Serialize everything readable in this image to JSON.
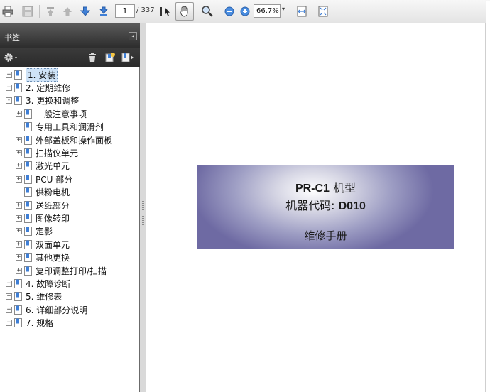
{
  "toolbar": {
    "page_current": "1",
    "page_total": "/ 337",
    "zoom_value": "66.7%",
    "icons": [
      "printer-icon",
      "save-icon",
      "first-page-icon",
      "prev-page-icon",
      "next-page-icon",
      "last-page-icon",
      "select-tool-icon",
      "hand-tool-icon",
      "zoom-tool-icon",
      "zoom-out-icon",
      "zoom-in-icon",
      "fit-width-icon",
      "fit-page-icon"
    ]
  },
  "panel": {
    "title": "书签",
    "collapse_symbol": "◂",
    "tools": [
      "options-gear-icon",
      "delete-bookmark-icon",
      "new-bookmark-icon",
      "expand-bookmark-icon"
    ]
  },
  "bookmarks": [
    {
      "label": "1. 安装",
      "level": 0,
      "state": "+",
      "selected": true
    },
    {
      "label": "2. 定期维修",
      "level": 0,
      "state": "+"
    },
    {
      "label": "3. 更换和调整",
      "level": 0,
      "state": "-"
    },
    {
      "label": "一般注意事项",
      "level": 1,
      "state": "+"
    },
    {
      "label": "专用工具和润滑剂",
      "level": 1,
      "state": ""
    },
    {
      "label": "外部盖板和操作面板",
      "level": 1,
      "state": "+"
    },
    {
      "label": "扫描仪单元",
      "level": 1,
      "state": "+"
    },
    {
      "label": "激光单元",
      "level": 1,
      "state": "+"
    },
    {
      "label": "PCU 部分",
      "level": 1,
      "state": "+"
    },
    {
      "label": "供粉电机",
      "level": 1,
      "state": ""
    },
    {
      "label": "送纸部分",
      "level": 1,
      "state": "+"
    },
    {
      "label": "图像转印",
      "level": 1,
      "state": "+"
    },
    {
      "label": "定影",
      "level": 1,
      "state": "+"
    },
    {
      "label": "双面单元",
      "level": 1,
      "state": "+"
    },
    {
      "label": "其他更换",
      "level": 1,
      "state": "+"
    },
    {
      "label": "复印调整打印/扫描",
      "level": 1,
      "state": "+"
    },
    {
      "label": "4. 故障诊断",
      "level": 0,
      "state": "+"
    },
    {
      "label": "5. 维修表",
      "level": 0,
      "state": "+"
    },
    {
      "label": "6. 详细部分说明",
      "level": 0,
      "state": "+"
    },
    {
      "label": "7. 规格",
      "level": 0,
      "state": "+"
    }
  ],
  "cover": {
    "model_bold": "PR-C1",
    "model_suffix": " 机型",
    "code_prefix": "机器代码: ",
    "code_bold": "D010",
    "subtitle": "维修手册"
  },
  "colors": {
    "panel_header": "#3a3a3a",
    "cover_gradient_dark": "#6e6aa3",
    "selection": "#cfe3f7",
    "nav_arrow": "#3f7fd6"
  }
}
